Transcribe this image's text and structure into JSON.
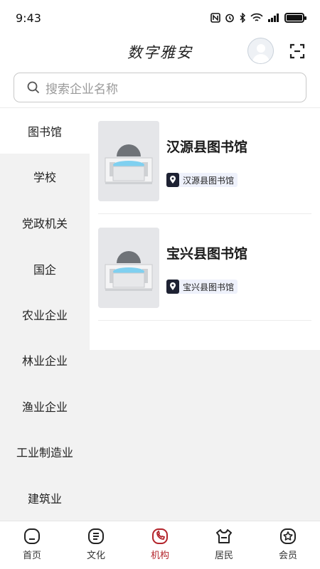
{
  "status_bar": {
    "time": "9:43",
    "icons": [
      "nfc-icon",
      "alarm-icon",
      "bluetooth-icon",
      "wifi-icon",
      "signal-icon",
      "battery-icon"
    ]
  },
  "header": {
    "title": "数字雅安",
    "avatar_icon": "user-avatar-icon",
    "scan_icon": "scan-icon"
  },
  "search": {
    "placeholder": "搜索企业名称"
  },
  "sidebar": {
    "items": [
      {
        "label": "图书馆",
        "active": true
      },
      {
        "label": "学校",
        "active": false
      },
      {
        "label": "党政机关",
        "active": false
      },
      {
        "label": "国企",
        "active": false
      },
      {
        "label": "农业企业",
        "active": false
      },
      {
        "label": "林业企业",
        "active": false
      },
      {
        "label": "渔业企业",
        "active": false
      },
      {
        "label": "工业制造业",
        "active": false
      },
      {
        "label": "建筑业",
        "active": false
      }
    ]
  },
  "content": {
    "entries": [
      {
        "title": "汉源县图书馆",
        "tag": "汉源县图书馆"
      },
      {
        "title": "宝兴县图书馆",
        "tag": "宝兴县图书馆"
      }
    ]
  },
  "bottom_nav": {
    "items": [
      {
        "label": "首页",
        "icon": "home-icon",
        "active": false
      },
      {
        "label": "文化",
        "icon": "culture-icon",
        "active": false
      },
      {
        "label": "机构",
        "icon": "institution-icon",
        "active": true
      },
      {
        "label": "居民",
        "icon": "resident-icon",
        "active": false
      },
      {
        "label": "会员",
        "icon": "member-icon",
        "active": false
      }
    ]
  },
  "colors": {
    "accent": "#b3242b",
    "sidebar_bg": "#f2f2f2",
    "tag_bg": "#eef1fb",
    "tag_icon_bg": "#1e2233"
  }
}
